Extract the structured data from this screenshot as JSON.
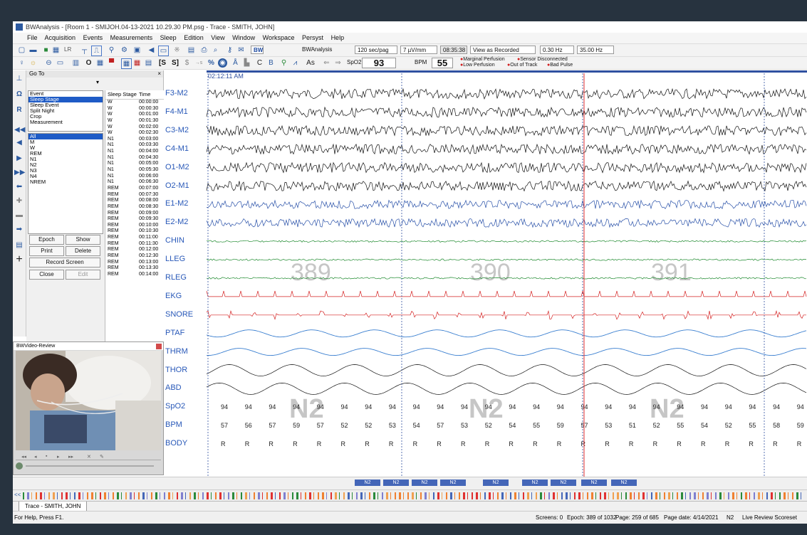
{
  "window_title": "BWAnalysis - [Room 1 - SMIJOH.04-13-2021 10.29.30 PM.psg - Trace - SMITH, JOHN]",
  "menu": [
    "File",
    "Acquisition",
    "Events",
    "Measurements",
    "Sleep",
    "Edition",
    "View",
    "Window",
    "Workspace",
    "Persyst",
    "Help"
  ],
  "toolbar": {
    "lr_label": "LR",
    "bw_logo": "BW",
    "bw_name": "BWAnalysis",
    "sec_per_page": "120 sec/pag",
    "uv_per_mm": "7 µV/mm",
    "clock": "08:35:38",
    "view_mode": "View as Recorded",
    "hp_filter": "0.30 Hz",
    "lp_filter": "35.00 Hz",
    "percent": "%",
    "c_label": "C",
    "b_label": "B",
    "as_label": "As",
    "spo2_label": "SpO2",
    "spo2_value": "93",
    "bpm_label": "BPM",
    "bpm_value": "55",
    "alerts": [
      "Marginal Perfusion",
      "Sensor Disconnected",
      "Low Perfusion",
      "Out of Track",
      "Bad Pulse"
    ]
  },
  "left_icons": [
    "R",
    "Ω",
    "R"
  ],
  "goto": {
    "title": "Go To",
    "close": "×",
    "categories": [
      "Event",
      "Sleep Stage",
      "Sleep Event",
      "Split Night",
      "Crop",
      "Measurement"
    ],
    "selected_category": 1,
    "stages": [
      "All",
      "M",
      "W",
      "REM",
      "N1",
      "N2",
      "N3",
      "N4",
      "NREM"
    ],
    "selected_stage": 0,
    "buttons": {
      "epoch": "Epoch",
      "show": "Show",
      "print": "Print",
      "delete": "Delete",
      "record": "Record Screen",
      "close": "Close",
      "edit": "Edit"
    },
    "table_header": [
      "Sleep Stage",
      "Time"
    ],
    "table_rows": [
      [
        "W",
        "00:00:00"
      ],
      [
        "W",
        "00:00:30"
      ],
      [
        "W",
        "00:01:00"
      ],
      [
        "W",
        "00:01:30"
      ],
      [
        "W",
        "00:02:00"
      ],
      [
        "W",
        "00:02:30"
      ],
      [
        "N1",
        "00:03:00"
      ],
      [
        "N1",
        "00:03:30"
      ],
      [
        "N1",
        "00:04:00"
      ],
      [
        "N1",
        "00:04:30"
      ],
      [
        "N1",
        "00:05:00"
      ],
      [
        "N1",
        "00:05:30"
      ],
      [
        "N1",
        "00:06:00"
      ],
      [
        "N1",
        "00:06:30"
      ],
      [
        "REM",
        "00:07:00"
      ],
      [
        "REM",
        "00:07:30"
      ],
      [
        "REM",
        "00:08:00"
      ],
      [
        "REM",
        "00:08:30"
      ],
      [
        "REM",
        "00:09:00"
      ],
      [
        "REM",
        "00:09:30"
      ],
      [
        "REM",
        "00:10:00"
      ],
      [
        "REM",
        "00:10:30"
      ],
      [
        "REM",
        "00:11:00"
      ],
      [
        "REM",
        "00:11:30"
      ],
      [
        "REM",
        "00:12:00"
      ],
      [
        "REM",
        "00:12:30"
      ],
      [
        "REM",
        "00:13:00"
      ],
      [
        "REM",
        "00:13:30"
      ],
      [
        "REM",
        "00:14:00"
      ]
    ]
  },
  "video": {
    "title": "BWVideo-Review"
  },
  "trace": {
    "start_time": "02:12:11 AM",
    "channels": [
      "F3-M2",
      "F4-M1",
      "C3-M2",
      "C4-M1",
      "O1-M2",
      "O2-M1",
      "E1-M2",
      "E2-M2",
      "CHIN",
      "LLEG",
      "RLEG",
      "EKG",
      "SNORE",
      "PTAF",
      "THRM",
      "THOR",
      "ABD",
      "SpO2",
      "BPM",
      "BODY"
    ],
    "channel_colors": {
      "eeg": "#111111",
      "eog": "#2850a8",
      "emg": "#1e8a2e",
      "ekg": "#d42020",
      "resp": "#3a7fd0"
    },
    "epochs": [
      "389",
      "390",
      "391"
    ],
    "stages": [
      "N2",
      "N2",
      "N2"
    ],
    "spo2_values": [
      "94",
      "94",
      "94",
      "94",
      "94",
      "94",
      "94",
      "94",
      "94",
      "94",
      "94",
      "94",
      "94",
      "94",
      "94",
      "94",
      "94",
      "94",
      "94",
      "94",
      "94",
      "94",
      "94",
      "94",
      "94"
    ],
    "bpm_values": [
      "57",
      "56",
      "57",
      "59",
      "57",
      "52",
      "52",
      "53",
      "54",
      "57",
      "53",
      "52",
      "54",
      "55",
      "59",
      "57",
      "53",
      "51",
      "52",
      "55",
      "54",
      "52",
      "55",
      "58",
      "59"
    ],
    "body_values": [
      "R",
      "R",
      "R",
      "R",
      "R",
      "R",
      "R",
      "R",
      "R",
      "R",
      "R",
      "R",
      "R",
      "R",
      "R",
      "R",
      "R",
      "R",
      "R",
      "R",
      "R",
      "R",
      "R",
      "R",
      "R"
    ]
  },
  "hypnogram_labels": [
    "N2",
    "N2",
    "N2",
    "N2",
    "N2",
    "N2",
    "N2",
    "N2",
    "N2"
  ],
  "tab_label": "Trace - SMITH, JOHN",
  "collapse_label": "<<",
  "status": {
    "help": "For Help, Press F1.",
    "screens": "Screens: 0",
    "epoch": "Epoch: 389 of 1032",
    "page": "Page: 259 of 685",
    "page_date": "Page date: 4/14/2021",
    "stage": "N2",
    "review": "Live Review Scoreset"
  }
}
